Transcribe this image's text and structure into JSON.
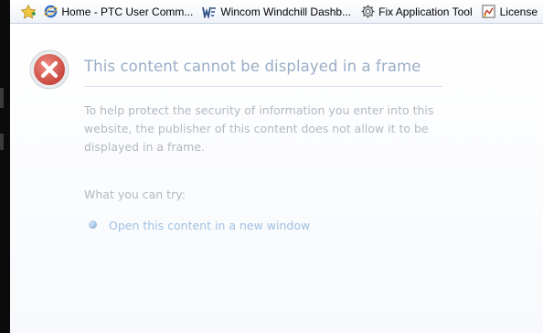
{
  "favorites_bar": {
    "items": [
      {
        "label": "Home - PTC User Comm...",
        "icon": "ie-icon"
      },
      {
        "label": "Wincom Windchill Dashb...",
        "icon": "windchill-icon"
      },
      {
        "label": "Fix Application Tool",
        "icon": "gear-icon"
      },
      {
        "label": "License",
        "icon": "license-icon"
      }
    ]
  },
  "error": {
    "title": "This content cannot be displayed in a frame",
    "description": "To help protect the security of information you enter into this website, the publisher of this content does not allow it to be displayed in a frame.",
    "try_heading": "What you can try:",
    "link_label": "Open this content in a new window"
  },
  "colors": {
    "title": "#9aaec6",
    "body_text": "#b2b8c1",
    "link": "#9fc0e2",
    "error_red": "#d9534f"
  }
}
